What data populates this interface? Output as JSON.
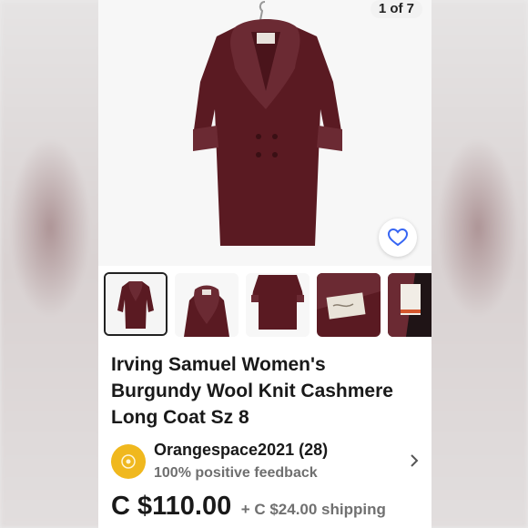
{
  "gallery": {
    "counter": "1 of 7",
    "thumbnails": [
      "front",
      "collar",
      "back",
      "label",
      "tag"
    ]
  },
  "listing": {
    "title": "Irving Samuel Women's Burgundy Wool Knit Cashmere Long Coat Sz 8",
    "price": "C $110.00",
    "shipping": "+ C $24.00 shipping"
  },
  "seller": {
    "name": "Orangespace2021 (28)",
    "feedback": "100% positive feedback"
  },
  "colors": {
    "coat": "#5a1a22",
    "fur": "#6b2a33",
    "heart": "#3665f3",
    "avatar": "#f0b81e"
  },
  "icons": {
    "favorite": "heart-icon",
    "seller_link": "chevron-right-icon"
  }
}
